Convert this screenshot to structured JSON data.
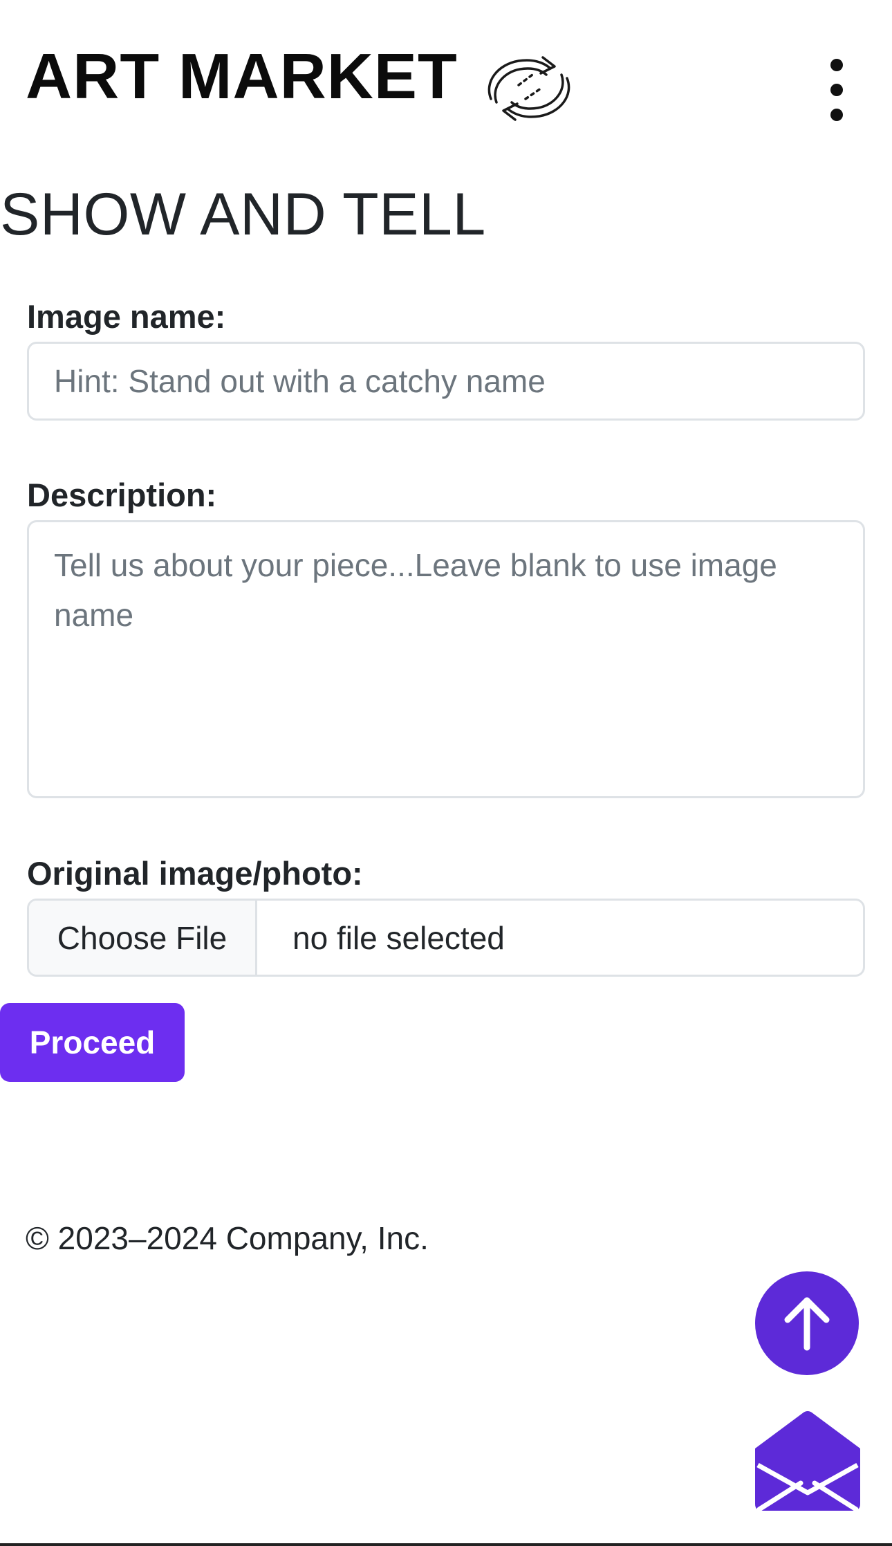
{
  "header": {
    "brand": "ART MARKET",
    "logo_icon": "rotate-arrows-icon",
    "menu_icon": "kebab-menu-icon"
  },
  "page": {
    "title": "SHOW AND TELL"
  },
  "form": {
    "image_name": {
      "label": "Image name:",
      "placeholder": "Hint: Stand out with a catchy name",
      "value": ""
    },
    "description": {
      "label": "Description:",
      "placeholder": "Tell us about your piece...Leave blank to use image name",
      "value": ""
    },
    "original_image": {
      "label": "Original image/photo:",
      "button_label": "Choose File",
      "status": "no file selected"
    },
    "proceed_label": "Proceed"
  },
  "footer": {
    "copyright": "© 2023–2024 Company, Inc."
  },
  "floating": {
    "scroll_top_icon": "arrow-up-icon",
    "contact_icon": "envelope-open-icon"
  },
  "colors": {
    "accent": "#6d2ef0",
    "fab": "#5d2ad8",
    "text": "#212529",
    "placeholder": "#6c757d",
    "border": "#dee2e6"
  }
}
